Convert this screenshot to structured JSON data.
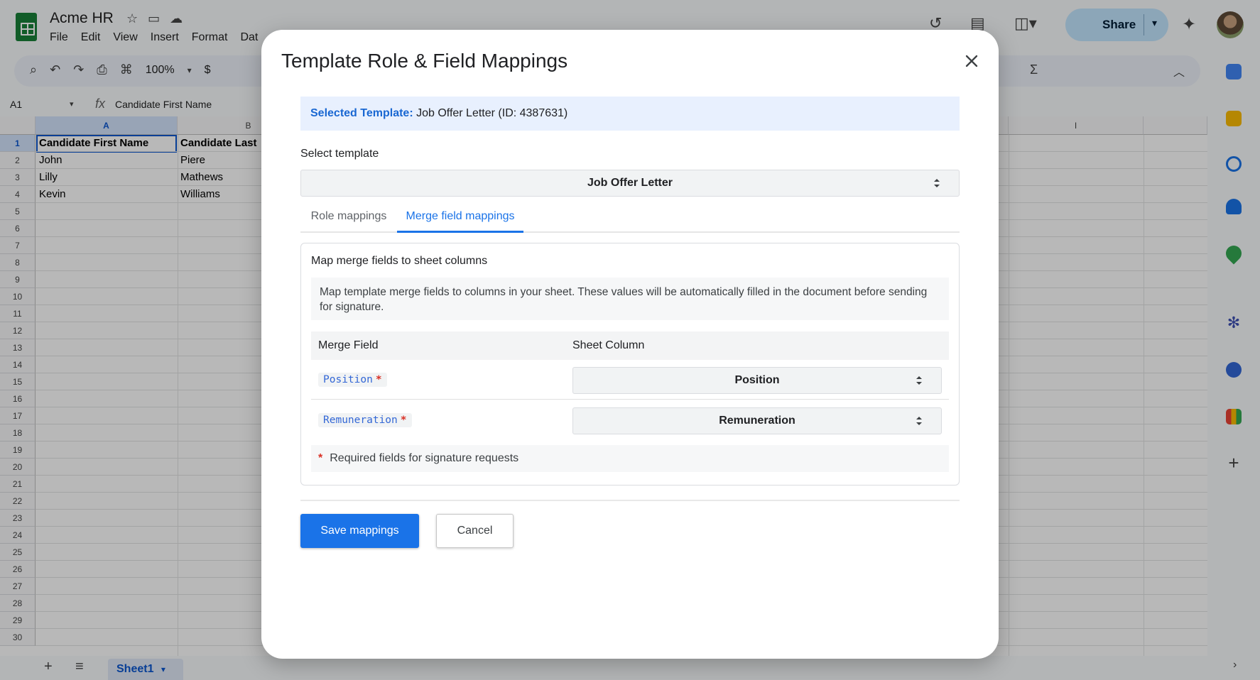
{
  "sheets": {
    "doc_title": "Acme HR",
    "menu": [
      "File",
      "Edit",
      "View",
      "Insert",
      "Format",
      "Dat"
    ],
    "share_label": "Share",
    "zoom": "100%",
    "currency_symbol": "$",
    "sigma": "Σ",
    "cell_ref": "A1",
    "formula_text": "Candidate First Name",
    "columns": [
      "A",
      "B",
      "I"
    ],
    "rows": [
      "1",
      "2",
      "3",
      "4",
      "5",
      "6",
      "7",
      "8",
      "9",
      "10",
      "11",
      "12",
      "13",
      "14",
      "15",
      "16",
      "17",
      "18",
      "19",
      "20",
      "21",
      "22",
      "23",
      "24",
      "25",
      "26",
      "27",
      "28",
      "29",
      "30"
    ],
    "cells": {
      "A1": "Candidate First Name",
      "B1": "Candidate Last",
      "A2": "John",
      "B2": "Piere",
      "A3": "Lilly",
      "B3": "Mathews",
      "A4": "Kevin",
      "B4": "Williams"
    },
    "sheet_tab": "Sheet1"
  },
  "modal": {
    "title": "Template Role & Field Mappings",
    "selected_label": "Selected Template:",
    "selected_value": "Job Offer Letter (ID: 4387631)",
    "select_template_label": "Select template",
    "template_value": "Job Offer Letter",
    "tabs": [
      {
        "label": "Role mappings",
        "active": false
      },
      {
        "label": "Merge field mappings",
        "active": true
      }
    ],
    "card_title": "Map merge fields to sheet columns",
    "info_text": "Map template merge fields to columns in your sheet. These values will be automatically filled in the document before sending for signature.",
    "table_headers": {
      "merge_field": "Merge Field",
      "sheet_column": "Sheet Column"
    },
    "mappings": [
      {
        "field": "Position",
        "required": "*",
        "column": "Position"
      },
      {
        "field": "Remuneration",
        "required": "*",
        "column": "Remuneration"
      }
    ],
    "required_star": "*",
    "required_note": "Required fields for signature requests",
    "save_label": "Save mappings",
    "cancel_label": "Cancel"
  },
  "colors": {
    "accent": "#1a73e8",
    "banner_bg": "#e8f0fe",
    "required": "#d93025",
    "sheets_green": "#188038"
  }
}
